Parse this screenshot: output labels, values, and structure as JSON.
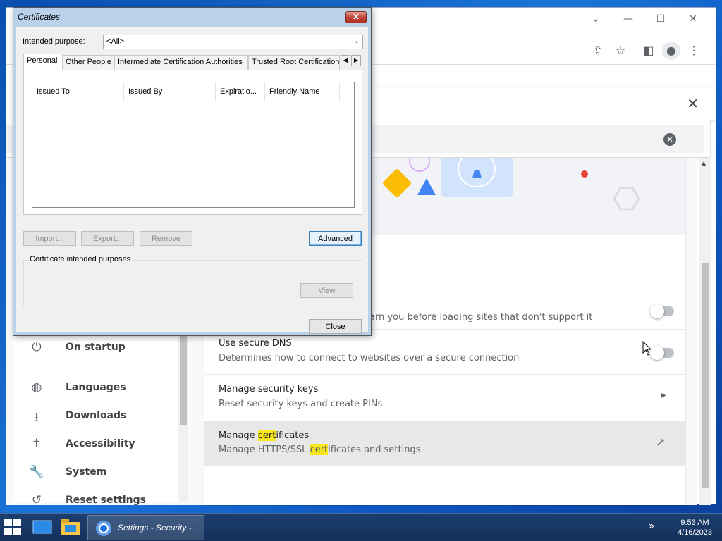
{
  "chrome": {
    "window_controls": [
      "chevron-down",
      "minimize",
      "maximize",
      "close"
    ]
  },
  "settings_nav": {
    "items": [
      {
        "label": "On startup",
        "icon": "power-icon"
      },
      {
        "label": "Languages",
        "icon": "globe-icon"
      },
      {
        "label": "Downloads",
        "icon": "download-icon"
      },
      {
        "label": "Accessibility",
        "icon": "accessibility-icon"
      },
      {
        "label": "System",
        "icon": "wrench-icon"
      },
      {
        "label": "Reset settings",
        "icon": "history-icon"
      }
    ]
  },
  "security_rows": {
    "https_sub": "arn you before loading sites that don't support it",
    "dns_title": "Use secure DNS",
    "dns_sub": "Determines how to connect to websites over a secure connection",
    "keys_title": "Manage security keys",
    "keys_sub": "Reset security keys and create PINs",
    "cert_title_a": "Manage ",
    "cert_title_hl": "cert",
    "cert_title_b": "ificates",
    "cert_sub_a": "Manage HTTPS/SSL ",
    "cert_sub_hl": "cert",
    "cert_sub_b": "ificates and settings"
  },
  "dialog": {
    "title": "Certificates",
    "close_glyph": "✕",
    "purpose_label": "Intended purpose:",
    "purpose_value": "<All>",
    "tabs": [
      "Personal",
      "Other People",
      "Intermediate Certification Authorities",
      "Trusted Root Certification"
    ],
    "columns": [
      "Issued To",
      "Issued By",
      "Expiratio...",
      "Friendly Name"
    ],
    "buttons": {
      "import": "Import...",
      "export": "Export...",
      "remove": "Remove",
      "advanced": "Advanced",
      "view": "View",
      "close": "Close"
    },
    "group_label": "Certificate intended purposes"
  },
  "taskbar": {
    "task_label": "Settings - Security - ...",
    "time": "9:53 AM",
    "date": "4/16/2023"
  },
  "colors": {
    "highlight": "#f8e71c",
    "dialog_frame": "#b9d1ea",
    "taskbar": "#14305a"
  }
}
